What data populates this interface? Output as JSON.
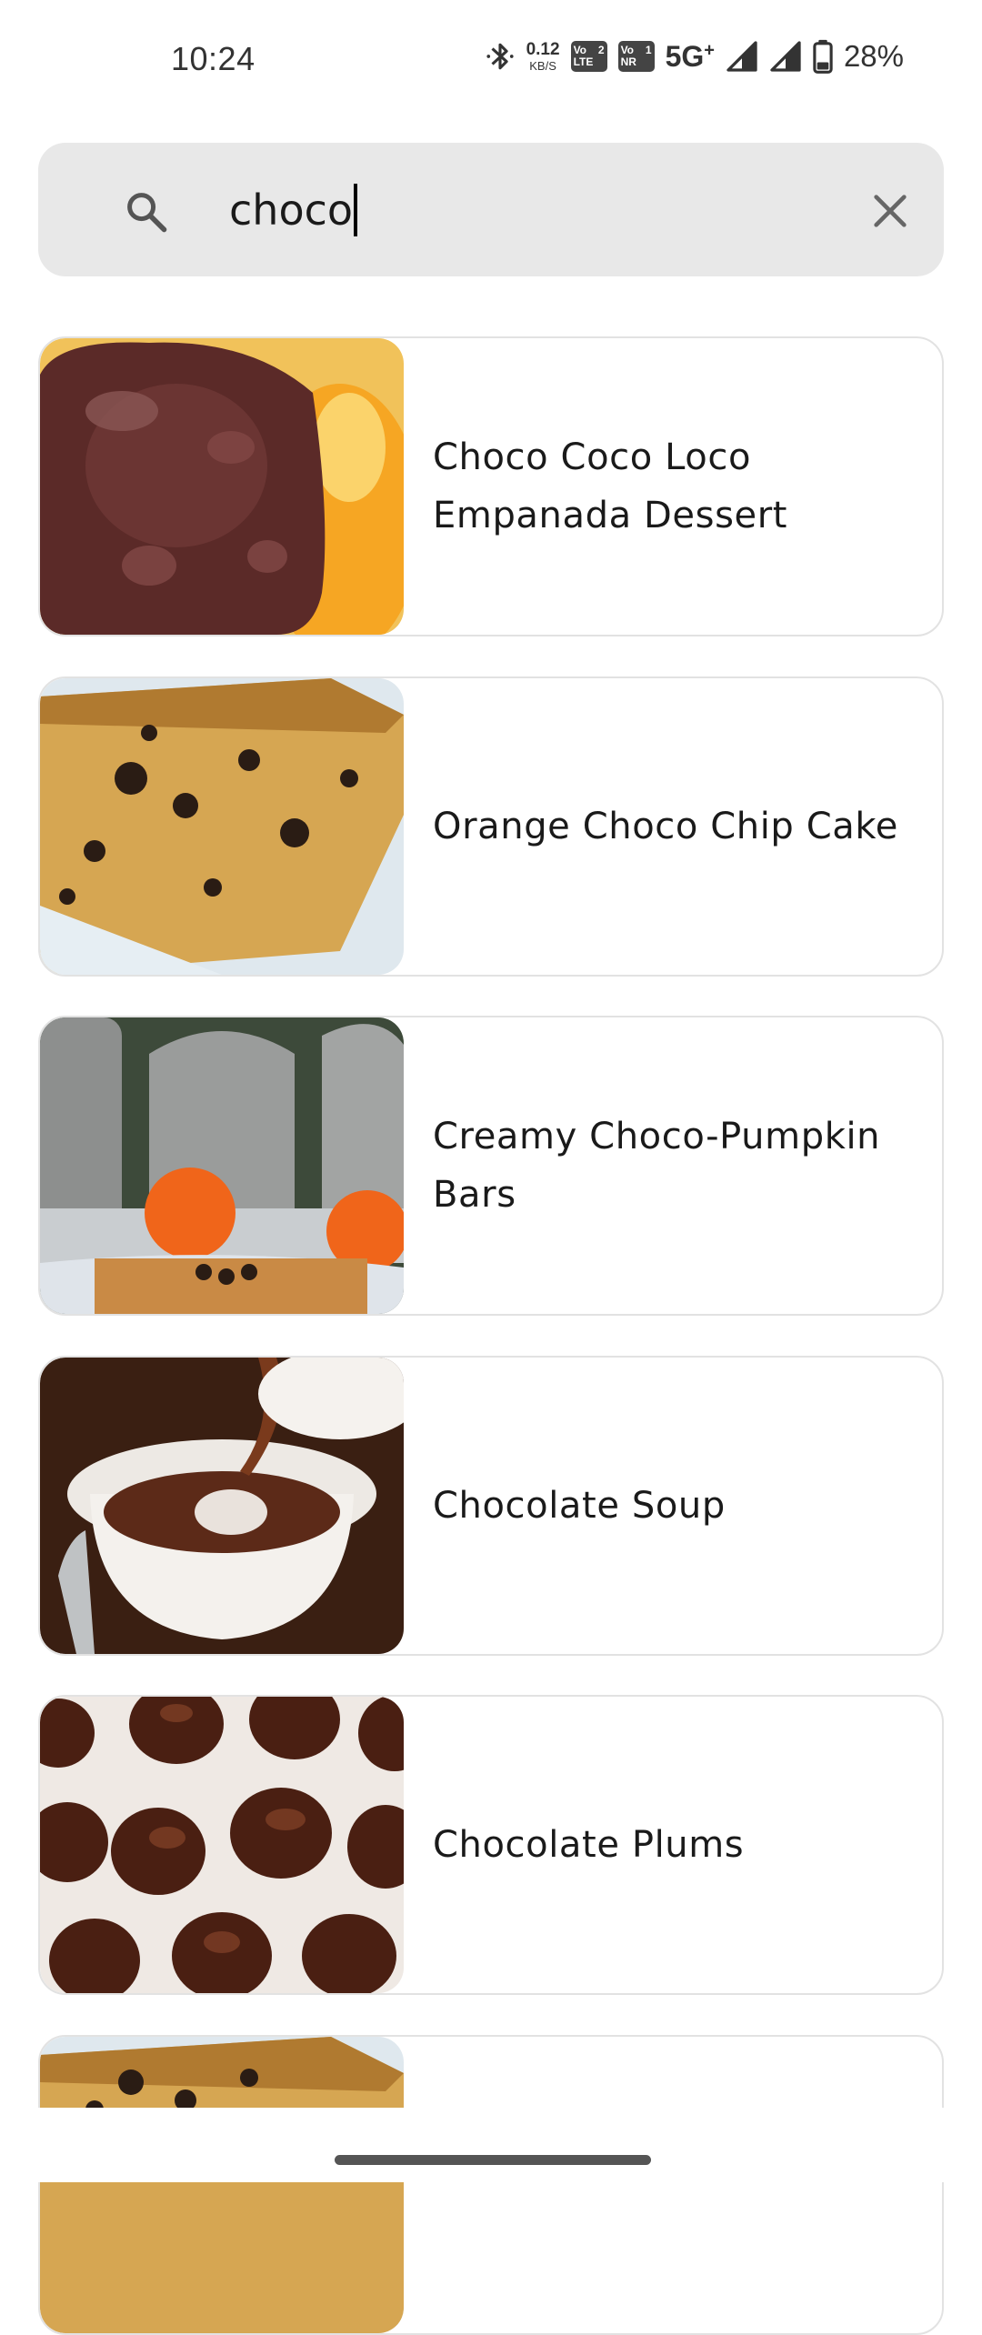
{
  "status_bar": {
    "time": "10:24",
    "speed_value": "0.12",
    "speed_unit": "KB/S",
    "sim1_top": "Vo",
    "sim1_num": "2",
    "sim1_bottom": "LTE",
    "sim2_top": "Vo",
    "sim2_num": "1",
    "sim2_bottom": "NR",
    "network": "5G",
    "network_plus": "+",
    "battery_percent": "28%",
    "battery_level": 0.28,
    "icons": [
      "bluetooth-icon",
      "signal-icon",
      "signal-icon",
      "battery-icon"
    ]
  },
  "search": {
    "query": "choco",
    "icon": "search-icon",
    "clear_icon": "close-icon"
  },
  "results": [
    {
      "title_line1": "Choco Coco Loco",
      "title_line2": "Empanada Dessert"
    },
    {
      "title_line1": "Orange Choco Chip Cake",
      "title_line2": ""
    },
    {
      "title_line1": "Creamy Choco-Pumpkin",
      "title_line2": "Bars"
    },
    {
      "title_line1": "Chocolate Soup",
      "title_line2": ""
    },
    {
      "title_line1": "Chocolate Plums",
      "title_line2": ""
    },
    {
      "title_line1": "",
      "title_line2": ""
    }
  ],
  "colors": {
    "search_bg": "#e8e8e8",
    "card_border": "#e2e2e2",
    "text": "#1a1a1a"
  }
}
